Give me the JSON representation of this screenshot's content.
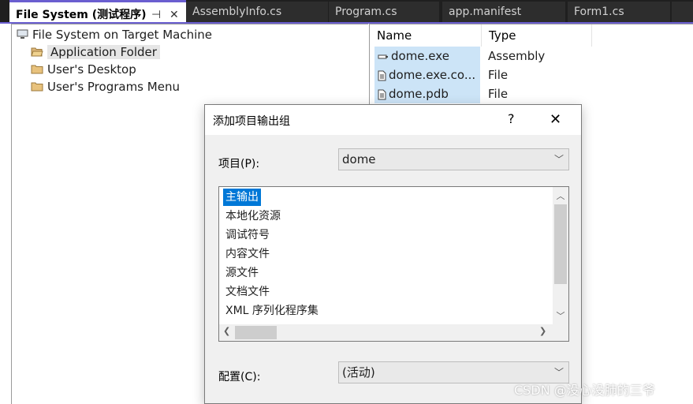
{
  "tabs": [
    {
      "label": "File System (测试程序)",
      "active": true
    },
    {
      "label": "AssemblyInfo.cs"
    },
    {
      "label": "Program.cs"
    },
    {
      "label": "app.manifest"
    },
    {
      "label": "Form1.cs"
    }
  ],
  "tree": {
    "root": {
      "label": "File System on Target Machine",
      "icon": "computer-icon"
    },
    "items": [
      {
        "label": "Application Folder",
        "icon": "folder-icon",
        "selected": true
      },
      {
        "label": "User's Desktop",
        "icon": "folder-icon"
      },
      {
        "label": "User's Programs Menu",
        "icon": "folder-icon"
      }
    ]
  },
  "file_list": {
    "columns": [
      "Name",
      "Type"
    ],
    "rows": [
      {
        "name": "dome.exe",
        "type": "Assembly",
        "icon": "assembly-icon"
      },
      {
        "name": "dome.exe.co...",
        "type": "File",
        "icon": "file-icon"
      },
      {
        "name": "dome.pdb",
        "type": "File",
        "icon": "file-icon"
      }
    ]
  },
  "dialog": {
    "title": "添加项目输出组",
    "help": "?",
    "close": "✕",
    "project_label": "项目(P):",
    "project_value": "dome",
    "outputs": [
      "主输出",
      "本地化资源",
      "调试符号",
      "内容文件",
      "源文件",
      "文档文件",
      "XML 序列化程序集"
    ],
    "selected_index": 0,
    "config_label": "配置(C):",
    "config_value": "(活动)"
  },
  "watermark": "CSDN @没心没肺的三爷",
  "colors": {
    "accent": "#6a5ed0",
    "selection": "#0078d7",
    "list_highlight": "#cce4f7"
  }
}
